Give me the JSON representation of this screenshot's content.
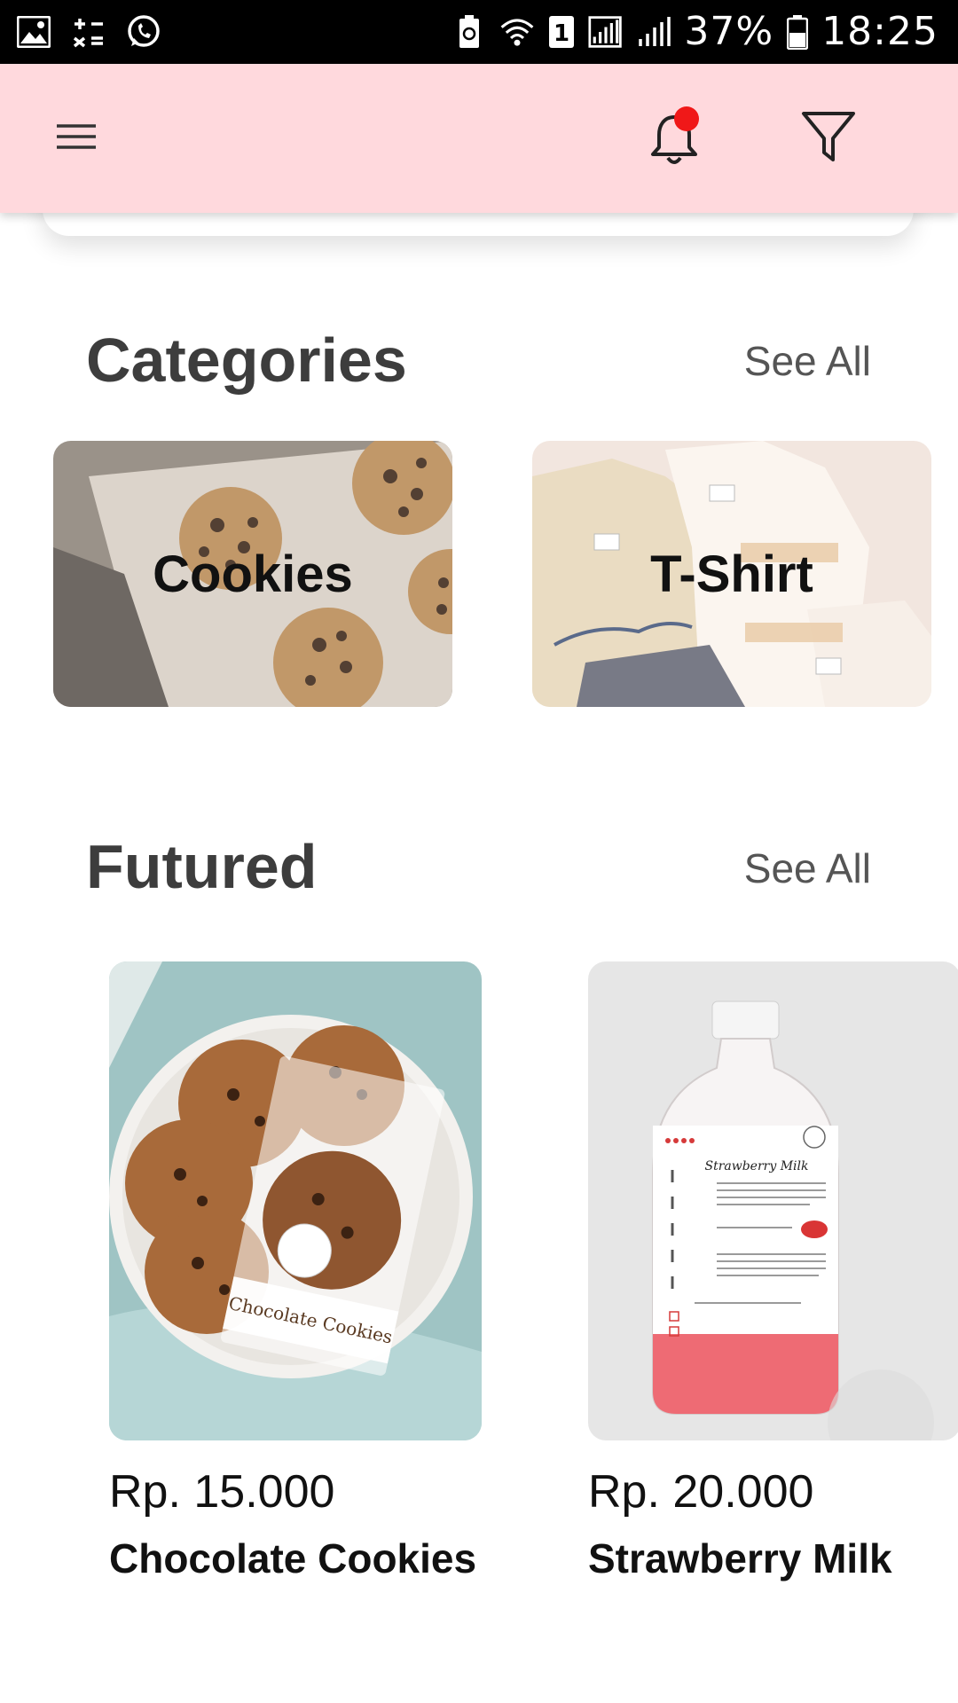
{
  "status_bar": {
    "battery": "37%",
    "time": "18:25",
    "sim_slot": "1"
  },
  "icons": {
    "menu": "menu-icon",
    "notifications": "bell-icon",
    "filter": "filter-icon"
  },
  "colors": {
    "app_bar": "#ffd9dd",
    "notification_dot": "#f01818",
    "section_title": "#3d3d3d"
  },
  "categories": {
    "title": "Categories",
    "see_all": "See All",
    "items": [
      {
        "label": "Cookies"
      },
      {
        "label": "T-Shirt"
      }
    ]
  },
  "featured": {
    "title": "Futured",
    "see_all": "See All",
    "items": [
      {
        "price": "Rp. 15.000",
        "name": "Chocolate Cookies",
        "package_label": "Chocolate Cookies"
      },
      {
        "price": "Rp. 20.000",
        "name": "Strawberry Milk",
        "bottle_label": "Strawberry Milk"
      }
    ]
  }
}
